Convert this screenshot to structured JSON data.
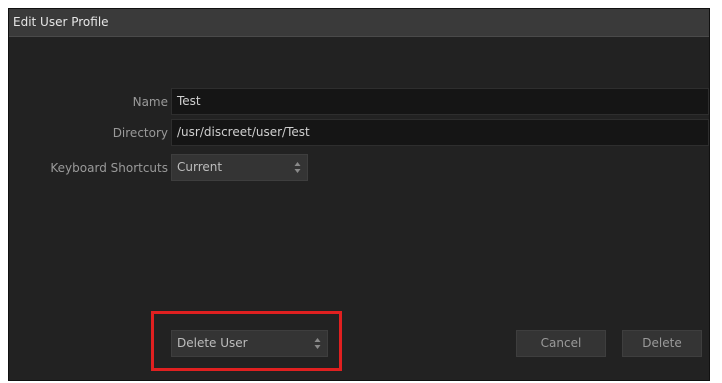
{
  "window": {
    "title": "Edit User Profile"
  },
  "form": {
    "name_label": "Name",
    "name_value": "Test",
    "directory_label": "Directory",
    "directory_value": "/usr/discreet/user/Test",
    "shortcuts_label": "Keyboard Shortcuts",
    "shortcuts_value": "Current"
  },
  "footer": {
    "user_action_value": "Delete User",
    "cancel_label": "Cancel",
    "delete_label": "Delete"
  },
  "annotation": {
    "highlight_color": "#e02020"
  },
  "icons": {
    "spinner": "up-down-arrows-icon"
  }
}
